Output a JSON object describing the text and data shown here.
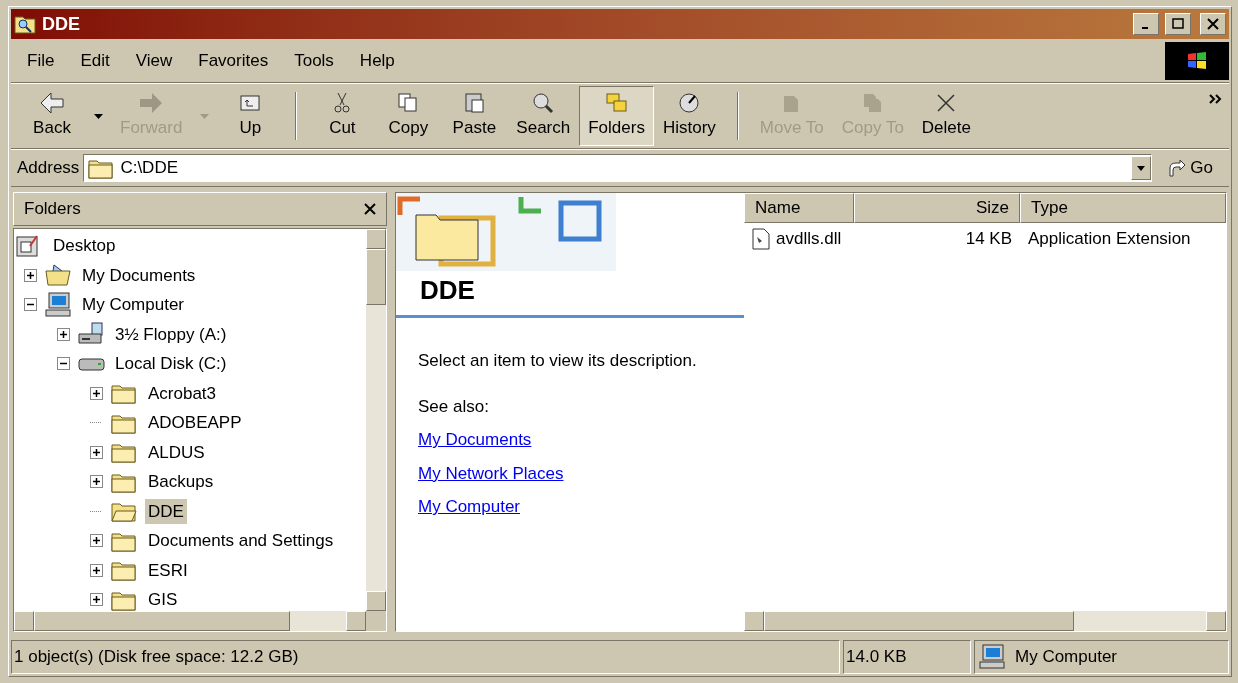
{
  "window": {
    "title": "DDE"
  },
  "menu": [
    "File",
    "Edit",
    "View",
    "Favorites",
    "Tools",
    "Help"
  ],
  "toolbar": [
    {
      "kind": "button",
      "label": "Back",
      "disabled": false,
      "selected": false,
      "dropdown": true
    },
    {
      "kind": "button",
      "label": "Forward",
      "disabled": true,
      "selected": false,
      "dropdown": true
    },
    {
      "kind": "button",
      "label": "Up",
      "disabled": false,
      "selected": false,
      "dropdown": false
    },
    {
      "kind": "separator"
    },
    {
      "kind": "button",
      "label": "Cut",
      "disabled": false,
      "selected": false,
      "dropdown": false
    },
    {
      "kind": "button",
      "label": "Copy",
      "disabled": false,
      "selected": false,
      "dropdown": false
    },
    {
      "kind": "button",
      "label": "Paste",
      "disabled": false,
      "selected": false,
      "dropdown": false
    },
    {
      "kind": "button",
      "label": "Search",
      "disabled": false,
      "selected": false,
      "dropdown": false
    },
    {
      "kind": "button",
      "label": "Folders",
      "disabled": false,
      "selected": true,
      "dropdown": false
    },
    {
      "kind": "button",
      "label": "History",
      "disabled": false,
      "selected": false,
      "dropdown": false
    },
    {
      "kind": "separator"
    },
    {
      "kind": "button",
      "label": "Move To",
      "disabled": true,
      "selected": false,
      "dropdown": false
    },
    {
      "kind": "button",
      "label": "Copy To",
      "disabled": true,
      "selected": false,
      "dropdown": false
    },
    {
      "kind": "button",
      "label": "Delete",
      "disabled": false,
      "selected": false,
      "dropdown": false
    }
  ],
  "address": {
    "label": "Address",
    "value": "C:\\DDE",
    "go": "Go"
  },
  "folders_pane": {
    "title": "Folders"
  },
  "tree": [
    {
      "label": "Desktop",
      "kind": "desktop",
      "selected": false,
      "children": [
        {
          "label": "My Documents",
          "kind": "documents",
          "has_toggle": true,
          "expanded": false,
          "selected": false
        },
        {
          "label": "My Computer",
          "kind": "computer",
          "has_toggle": true,
          "expanded": true,
          "selected": false,
          "children": [
            {
              "label": "3½ Floppy (A:)",
              "kind": "floppy",
              "has_toggle": true,
              "expanded": false,
              "selected": false
            },
            {
              "label": "Local Disk (C:)",
              "kind": "drive",
              "has_toggle": true,
              "expanded": true,
              "selected": false,
              "children": [
                {
                  "label": "Acrobat3",
                  "kind": "folder",
                  "has_toggle": true,
                  "expanded": false,
                  "selected": false
                },
                {
                  "label": "ADOBEAPP",
                  "kind": "folder",
                  "selected": false
                },
                {
                  "label": "ALDUS",
                  "kind": "folder",
                  "has_toggle": true,
                  "expanded": false,
                  "selected": false
                },
                {
                  "label": "Backups",
                  "kind": "folder",
                  "has_toggle": true,
                  "expanded": false,
                  "selected": false
                },
                {
                  "label": "DDE",
                  "kind": "folder",
                  "selected": true
                },
                {
                  "label": "Documents and Settings",
                  "kind": "folder",
                  "has_toggle": true,
                  "expanded": false,
                  "selected": false
                },
                {
                  "label": "ESRI",
                  "kind": "folder",
                  "has_toggle": true,
                  "expanded": false,
                  "selected": false
                },
                {
                  "label": "GIS",
                  "kind": "folder",
                  "has_toggle": true,
                  "expanded": false,
                  "selected": false
                }
              ]
            }
          ]
        }
      ]
    }
  ],
  "web_panel": {
    "heading": "DDE",
    "description": "Select an item to view its description.",
    "see_also": "See also:",
    "links": [
      "My Documents",
      "My Network Places",
      "My Computer"
    ]
  },
  "file_list": {
    "columns": [
      "Name",
      "Size",
      "Type"
    ],
    "rows": [
      {
        "cells": [
          "avdlls.dll",
          "14 KB",
          "Application Extension"
        ]
      }
    ]
  },
  "status_bar": {
    "text": "1 object(s) (Disk free space: 12.2 GB)",
    "size": "14.0 KB",
    "zone": "My Computer"
  }
}
